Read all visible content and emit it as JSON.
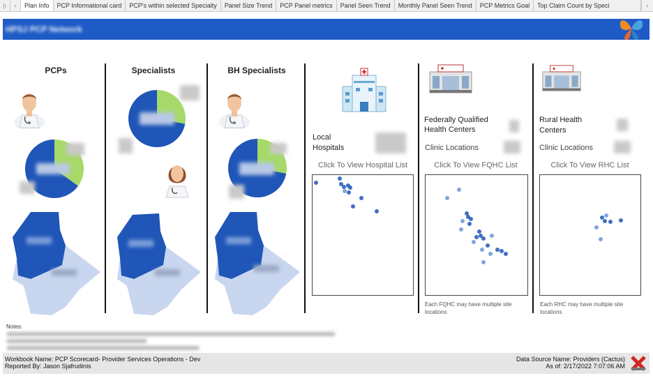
{
  "tabs": [
    "Plan Info",
    "PCP Informational card",
    "PCP's within selected Specialty",
    "Panel Size Trend",
    "PCP Panel metrics",
    "Panel Seen Trend",
    "Monthly Panel Seen Trend",
    "PCP Metrics Goal",
    "Top Claim Count by Speci"
  ],
  "active_tab": "Plan Info",
  "header": {
    "title": "HPSJ PCP Network"
  },
  "columns": {
    "pcps": {
      "title": "PCPs",
      "pie_fraction_green": 0.35
    },
    "specialists": {
      "title": "Specialists",
      "pie_fraction_green": 0.28
    },
    "bh": {
      "title": "BH Specialists",
      "pie_fraction_green": 0.28
    }
  },
  "facilities": {
    "hospitals": {
      "label": "Local Hospitals",
      "link": "Click To View Hospital List"
    },
    "fqhc": {
      "label": "Federally Qualified Health Centers",
      "sublabel": "Clinic Locations",
      "link": "Click To View FQHC List",
      "note": "Each FQHC may have multiple site locations"
    },
    "rhc": {
      "label": "Rural Health Centers",
      "sublabel": "Clinic Locations",
      "link": "Click To View RHC List",
      "note": "Each RHC may have multiple site locations"
    }
  },
  "notes_label": "Notes:",
  "footer": {
    "workbook": "Workbook Name: PCP Scorecard- Provider Services Operations - Dev",
    "reported_by": "Reported By: Jason Sjafrudinis",
    "data_source": "Data Source Name: Providers (Cactus)",
    "as_of": "As of: 2/17/2022 7:07:06 AM"
  },
  "colors": {
    "brand_blue": "#1e5bc6",
    "pie_blue": "#1f56b8",
    "pie_green": "#a6d96a",
    "map_dark": "#1f56b8",
    "map_light": "#c9d6ef"
  }
}
